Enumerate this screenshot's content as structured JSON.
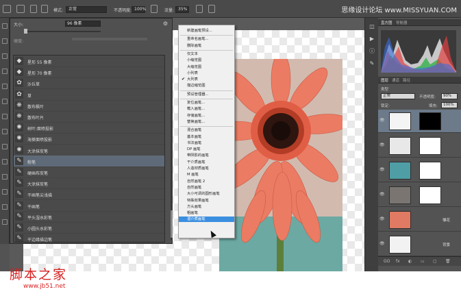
{
  "options_bar": {
    "mode_label": "模式:",
    "mode_value": "正常",
    "opacity_label": "不透明度:",
    "opacity_value": "100%",
    "flow_label": "流量:",
    "flow_value": "35%",
    "site_watermark": "思缘设计论坛 www.MISSYUAN.COM"
  },
  "brush_picker": {
    "size_label": "大小:",
    "size_value": "96 像素",
    "hardness_label": "硬度:",
    "items": [
      {
        "thumb": "◆",
        "label": "星形 55 像素",
        "selected": false
      },
      {
        "thumb": "◆",
        "label": "星形 70 像素",
        "selected": false
      },
      {
        "thumb": "✿",
        "label": "沙丘草",
        "selected": false
      },
      {
        "thumb": "✿",
        "label": "草",
        "selected": false
      },
      {
        "thumb": "❋",
        "label": "散布枫叶",
        "selected": false
      },
      {
        "thumb": "❋",
        "label": "散布叶片",
        "selected": false
      },
      {
        "thumb": "✺",
        "label": "树叶:面喷投影",
        "selected": false
      },
      {
        "thumb": "✺",
        "label": "海葵面喷投影",
        "selected": false
      },
      {
        "thumb": "✺",
        "label": "大涂抹炭笔",
        "selected": false
      },
      {
        "thumb": "✎",
        "label": "粉笔",
        "selected": true
      },
      {
        "thumb": "✎",
        "label": "硬画布炭笔",
        "selected": false
      },
      {
        "thumb": "✎",
        "label": "大涂抹炭笔",
        "selected": false
      },
      {
        "thumb": "✎",
        "label": "干画笔尖浅描",
        "selected": false
      },
      {
        "thumb": "✎",
        "label": "干画笔",
        "selected": false
      },
      {
        "thumb": "✎",
        "label": "平头湿水彩笔",
        "selected": false
      },
      {
        "thumb": "✎",
        "label": "小圆头水彩笔",
        "selected": false
      },
      {
        "thumb": "✎",
        "label": "干边缘描边笔",
        "selected": false
      }
    ]
  },
  "flyout_menu": {
    "items": [
      {
        "label": "新建画笔预设...",
        "checked": false,
        "highlight": false,
        "sep_after": true
      },
      {
        "label": "重命名画笔...",
        "checked": false,
        "highlight": false,
        "sep_after": false
      },
      {
        "label": "删除画笔",
        "checked": false,
        "highlight": false,
        "sep_after": true
      },
      {
        "label": "仅文本",
        "checked": false,
        "highlight": false,
        "sep_after": false
      },
      {
        "label": "小缩览图",
        "checked": false,
        "highlight": false,
        "sep_after": false
      },
      {
        "label": "大缩览图",
        "checked": false,
        "highlight": false,
        "sep_after": false
      },
      {
        "label": "小列表",
        "checked": false,
        "highlight": false,
        "sep_after": false
      },
      {
        "label": "大列表",
        "checked": true,
        "highlight": false,
        "sep_after": false
      },
      {
        "label": "描边缩览图",
        "checked": false,
        "highlight": false,
        "sep_after": true
      },
      {
        "label": "预设管理器...",
        "checked": false,
        "highlight": false,
        "sep_after": true
      },
      {
        "label": "复位画笔...",
        "checked": false,
        "highlight": false,
        "sep_after": false
      },
      {
        "label": "载入画笔...",
        "checked": false,
        "highlight": false,
        "sep_after": false
      },
      {
        "label": "存储画笔...",
        "checked": false,
        "highlight": false,
        "sep_after": false
      },
      {
        "label": "替换画笔...",
        "checked": false,
        "highlight": false,
        "sep_after": true
      },
      {
        "label": "混合画笔",
        "checked": false,
        "highlight": false,
        "sep_after": false
      },
      {
        "label": "基本画笔",
        "checked": false,
        "highlight": false,
        "sep_after": false
      },
      {
        "label": "书法画笔",
        "checked": false,
        "highlight": false,
        "sep_after": false
      },
      {
        "label": "DP 画笔",
        "checked": false,
        "highlight": false,
        "sep_after": false
      },
      {
        "label": "带阴影的画笔",
        "checked": false,
        "highlight": false,
        "sep_after": false
      },
      {
        "label": "干介质画笔",
        "checked": false,
        "highlight": false,
        "sep_after": false
      },
      {
        "label": "人造材质画笔",
        "checked": false,
        "highlight": false,
        "sep_after": false
      },
      {
        "label": "M 画笔",
        "checked": false,
        "highlight": false,
        "sep_after": false
      },
      {
        "label": "自然画笔 2",
        "checked": false,
        "highlight": false,
        "sep_after": false
      },
      {
        "label": "自然画笔",
        "checked": false,
        "highlight": false,
        "sep_after": false
      },
      {
        "label": "大小可调的圆形画笔",
        "checked": false,
        "highlight": false,
        "sep_after": false
      },
      {
        "label": "特殊效果画笔",
        "checked": false,
        "highlight": false,
        "sep_after": false
      },
      {
        "label": "方头画笔",
        "checked": false,
        "highlight": false,
        "sep_after": false
      },
      {
        "label": "粗画笔",
        "checked": false,
        "highlight": false,
        "sep_after": false
      },
      {
        "label": "湿介质画笔",
        "checked": false,
        "highlight": true,
        "sep_after": false
      }
    ]
  },
  "right_panels": {
    "histogram_tabs": [
      "直方图",
      "导航器"
    ],
    "layers_tabs": [
      "图层",
      "通道",
      "路径"
    ],
    "kind_label": "类型",
    "blend_value": "正常",
    "opacity_label": "不透明度:",
    "opacity_value": "90%",
    "lock_label": "锁定:",
    "fill_label": "填充:",
    "fill_value": "100%",
    "layers": [
      {
        "name": "",
        "thumb": "#f4f4f4",
        "mask": "#000000",
        "selected": true
      },
      {
        "name": "",
        "thumb": "#e8e8e8",
        "mask": "#ffffff",
        "selected": false
      },
      {
        "name": "",
        "thumb": "#4f9da5",
        "mask": "#ffffff",
        "selected": false
      },
      {
        "name": "",
        "thumb": "#7a7571",
        "mask": "#ffffff",
        "selected": false
      },
      {
        "name": "雏花",
        "thumb": "#e07a62",
        "mask": "",
        "selected": false
      },
      {
        "name": "背景",
        "thumb": "#f2f2f2",
        "mask": "",
        "selected": false
      }
    ],
    "footer_icons": [
      "GO",
      "fx",
      "◐",
      "▭",
      "▢",
      "🗑"
    ]
  },
  "watermark": {
    "title": "脚本之家",
    "url": "www.jb51.net"
  },
  "colors": {
    "highlight": "#3b8fe0",
    "selected_row": "#5f6a78",
    "watermark_red": "#d81f1f"
  }
}
